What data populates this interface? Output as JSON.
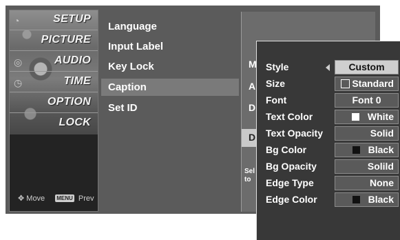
{
  "categories": [
    {
      "label": "SETUP"
    },
    {
      "label": "PICTURE"
    },
    {
      "label": "AUDIO"
    },
    {
      "label": "TIME"
    },
    {
      "label": "OPTION"
    },
    {
      "label": "LOCK"
    }
  ],
  "footer": {
    "move_label": "Move",
    "menu_key": "MENU",
    "prev_label": "Prev"
  },
  "option_menu": {
    "items": [
      {
        "label": "Language"
      },
      {
        "label": "Input Label"
      },
      {
        "label": "Key Lock"
      },
      {
        "label": "Caption"
      },
      {
        "label": "Set ID"
      }
    ],
    "selected": "Caption"
  },
  "caption_panel": {
    "items_partial": [
      "M",
      "A",
      "D",
      "D"
    ],
    "help_partial": [
      "Sel",
      "to"
    ]
  },
  "style_popup": {
    "rows": [
      {
        "label": "Style",
        "value": "Custom"
      },
      {
        "label": "Size",
        "value": "Standard"
      },
      {
        "label": "Font",
        "value": "Font 0"
      },
      {
        "label": "Text Color",
        "value": "White",
        "swatch": "#ffffff"
      },
      {
        "label": "Text Opacity",
        "value": "Solid"
      },
      {
        "label": "Bg Color",
        "value": "Black",
        "swatch": "#111111"
      },
      {
        "label": "Bg Opacity",
        "value": "Solild"
      },
      {
        "label": "Edge Type",
        "value": "None"
      },
      {
        "label": "Edge Color",
        "value": "Black",
        "swatch": "#111111"
      }
    ]
  },
  "colors": {
    "highlight": "#7a7a7a",
    "active_value_bg": "#cfcfcf",
    "panel_bg": "#5b5b5b"
  }
}
